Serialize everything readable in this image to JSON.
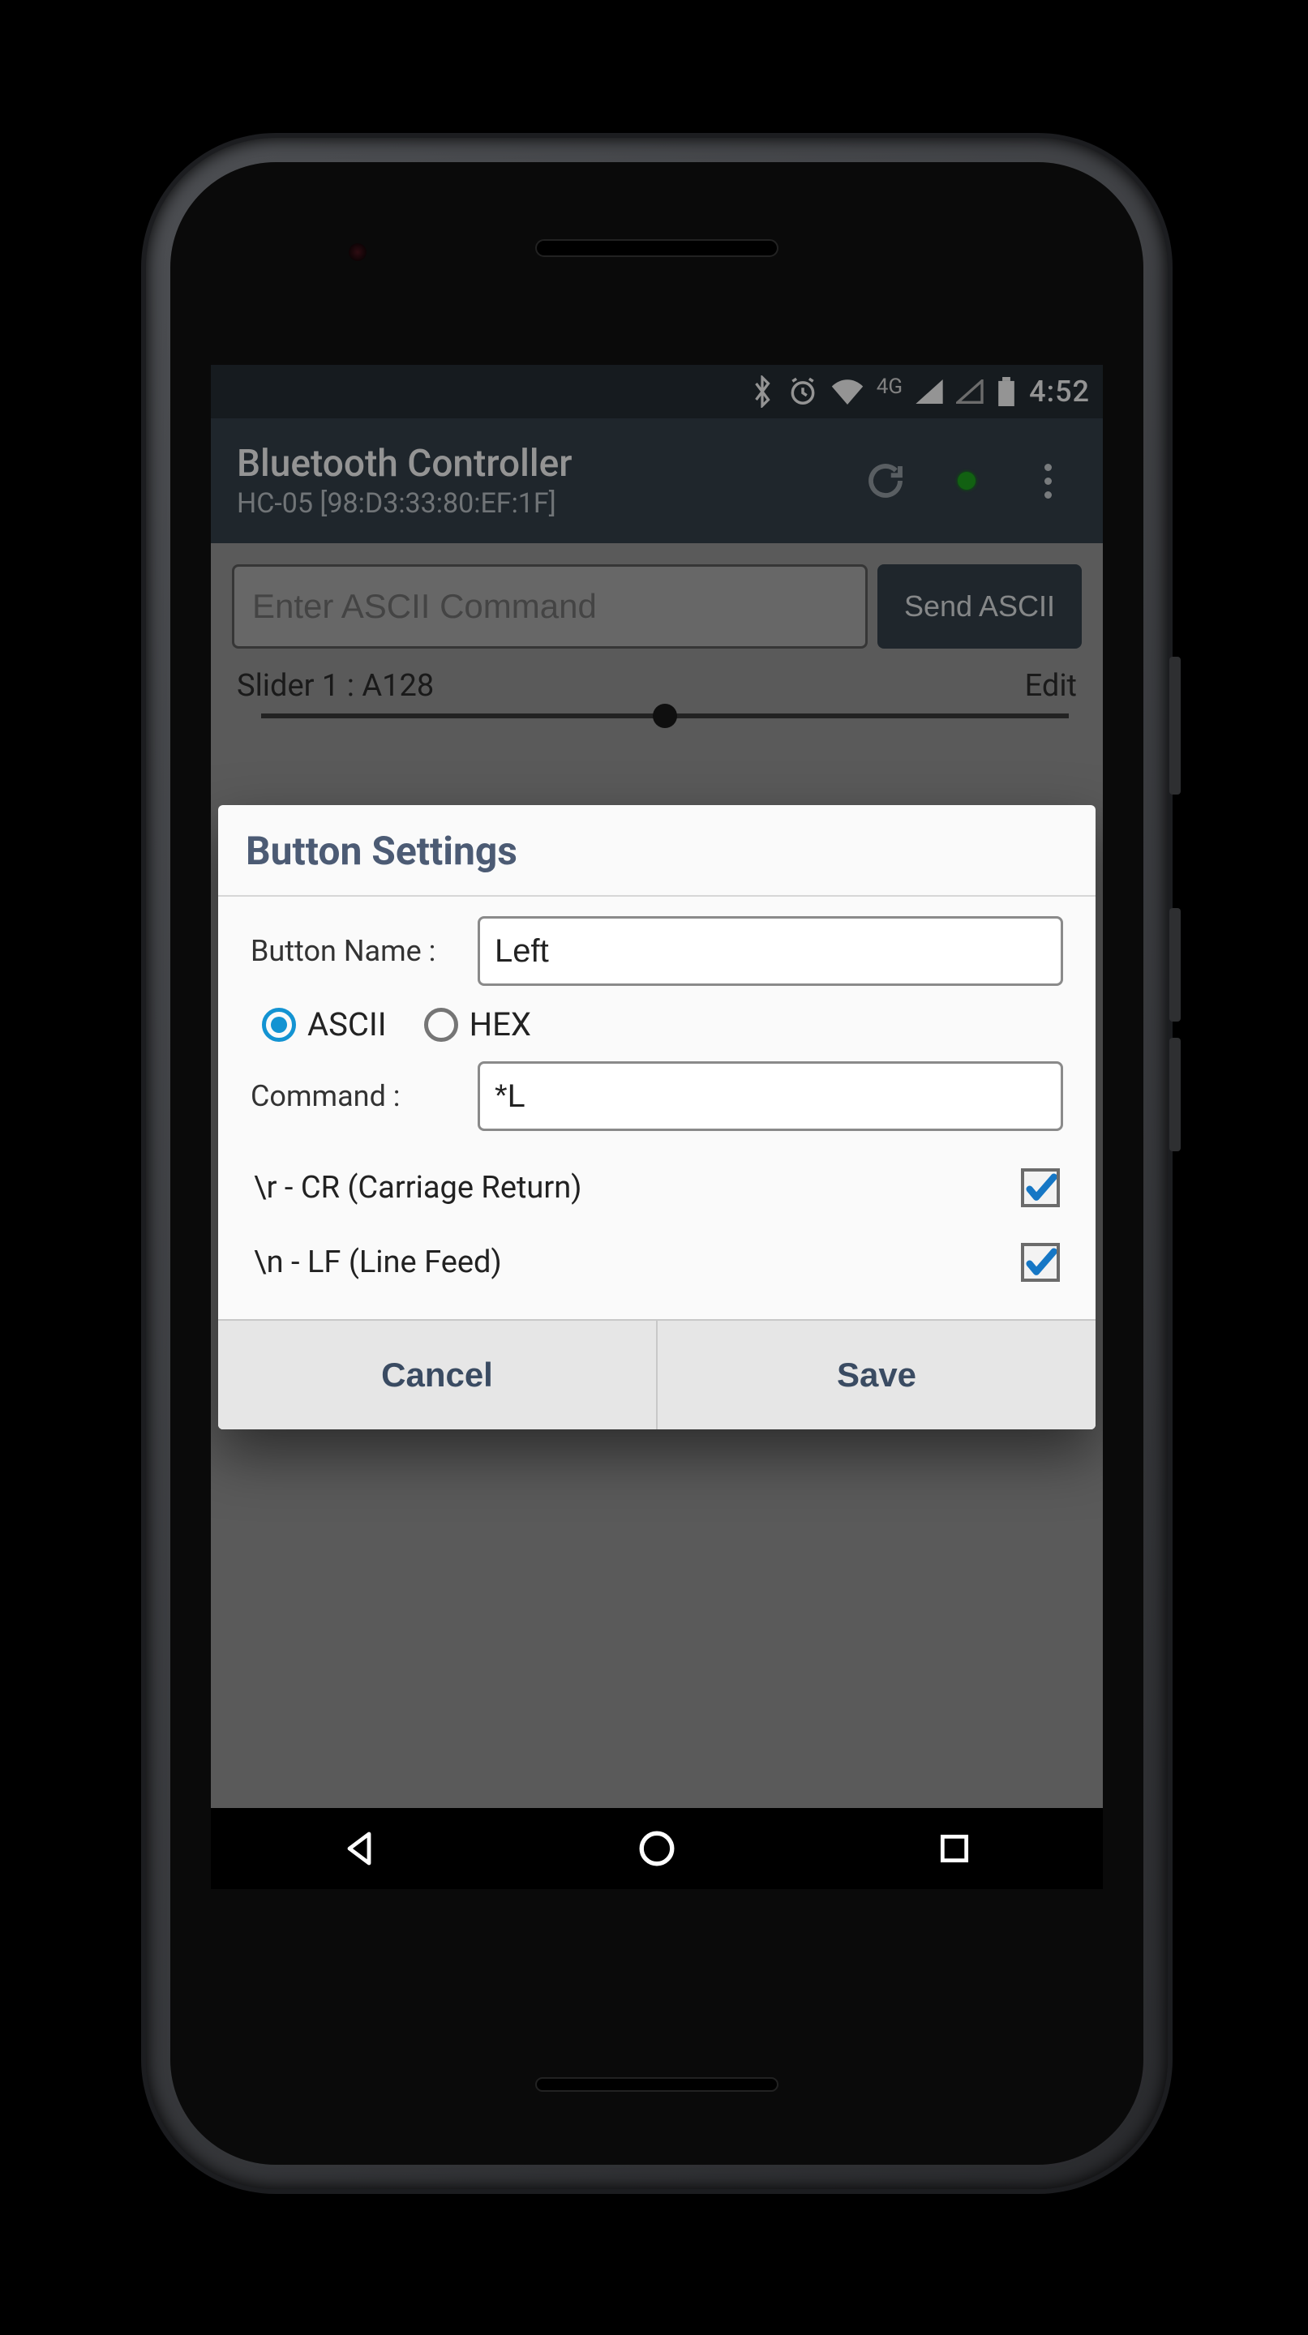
{
  "status": {
    "network_label": "4G",
    "time": "4:52"
  },
  "appbar": {
    "title": "Bluetooth Controller",
    "subtitle": "HC-05 [98:D3:33:80:EF:1F]"
  },
  "background": {
    "command_placeholder": "Enter ASCII Command",
    "send_label": "Send ASCII",
    "slider_label": "Slider 1 : A128",
    "edit_label": "Edit"
  },
  "dialog": {
    "title": "Button Settings",
    "name_label": "Button Name :",
    "name_value": "Left",
    "radio_ascii": "ASCII",
    "radio_hex": "HEX",
    "command_label": "Command     :",
    "command_value": "*L",
    "cr_label": "\\r - CR (Carriage Return)",
    "lf_label": "\\n - LF (Line Feed)",
    "cancel": "Cancel",
    "save": "Save"
  }
}
